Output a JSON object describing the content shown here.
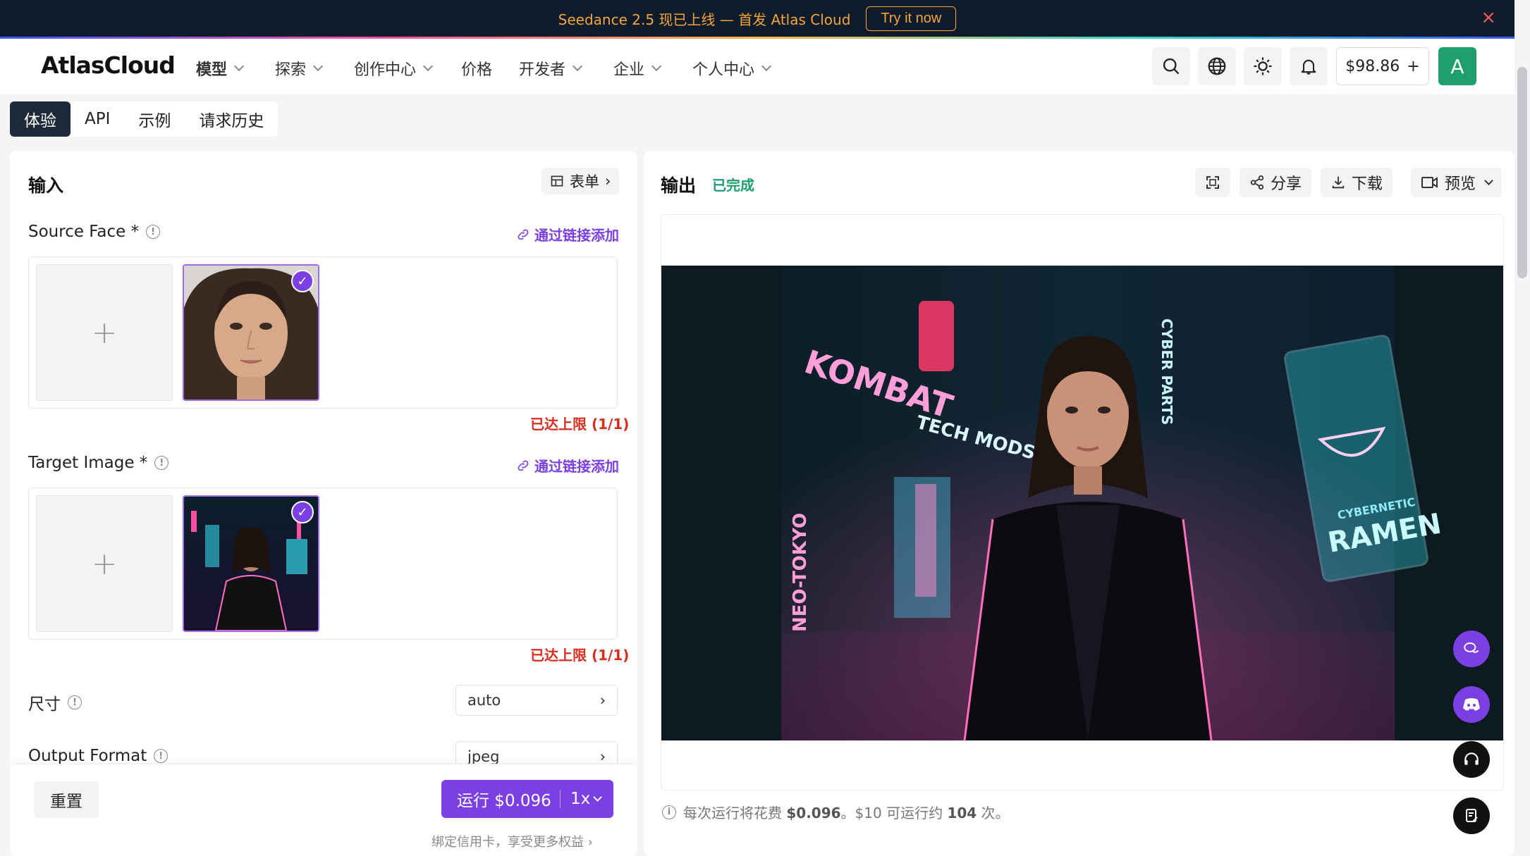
{
  "banner": {
    "text": "Seedance 2.5 现已上线 — 首发 Atlas Cloud",
    "cta": "Try it now",
    "close": "×"
  },
  "header": {
    "logo": "AtlasCloud",
    "nav": [
      {
        "label": "模型"
      },
      {
        "label": "探索"
      },
      {
        "label": "创作中心"
      },
      {
        "label": "价格"
      },
      {
        "label": "开发者"
      },
      {
        "label": "企业"
      },
      {
        "label": "个人中心"
      }
    ],
    "balance": "$98.86",
    "balance_plus": "+",
    "avatar": "A"
  },
  "tabs": [
    "体验",
    "API",
    "示例",
    "请求历史"
  ],
  "input": {
    "title": "输入",
    "form_btn": "表单",
    "source_face": {
      "label": "Source Face *",
      "link": "通过链接添加",
      "limit": "已达上限 (1/1)"
    },
    "target_image": {
      "label": "Target Image *",
      "link": "通过链接添加",
      "limit": "已达上限 (1/1)"
    },
    "size": {
      "label": "尺寸",
      "value": "auto"
    },
    "output_format": {
      "label": "Output Format",
      "value": "jpeg"
    },
    "reset": "重置",
    "run": "运行 $0.096",
    "multiplier": "1x",
    "bind_card": "绑定信用卡，享受更多权益 ›"
  },
  "output": {
    "title": "输出",
    "status": "已完成",
    "share": "分享",
    "download": "下载",
    "preview": "预览",
    "cost_note_prefix": "每次运行将花费 ",
    "cost_value": "$0.096",
    "cost_note_mid": "。$10 可运行约 ",
    "cost_runs": "104",
    "cost_note_suffix": " 次。",
    "signs": [
      "KOMBAT",
      "TECH MODS",
      "NEO-TOKYO",
      "CYBER PARTS",
      "RAMEN",
      "CYBERNETIC"
    ]
  },
  "colors": {
    "accent": "#7b3fe4",
    "success": "#1f9e6e",
    "danger": "#d92d20",
    "banner_bg": "#0e1b2b",
    "banner_text": "#f3a53c"
  }
}
